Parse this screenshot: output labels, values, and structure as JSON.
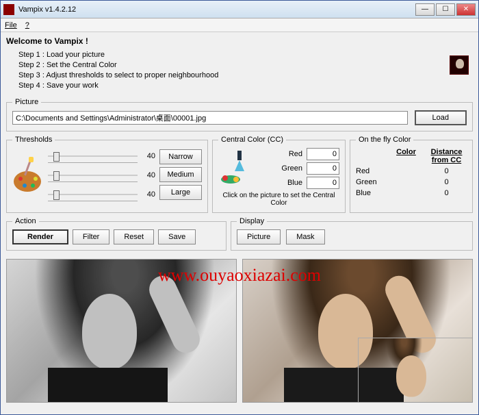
{
  "window": {
    "title": "Vampix v1.4.2.12"
  },
  "menu": {
    "file": "File",
    "help": "?"
  },
  "welcome": {
    "heading": "Welcome to Vampix !",
    "steps": [
      "Step 1 : Load your picture",
      "Step 2 : Set the Central Color",
      "Step 3 : Adjust thresholds to select to proper neighbourhood",
      "Step 4 : Save your work"
    ]
  },
  "picture": {
    "legend": "Picture",
    "path": "C:\\Documents and Settings\\Administrator\\桌面\\00001.jpg",
    "load": "Load"
  },
  "thresholds": {
    "legend": "Thresholds",
    "values": [
      "40",
      "40",
      "40"
    ],
    "narrow": "Narrow",
    "medium": "Medium",
    "large": "Large"
  },
  "cc": {
    "legend": "Central Color (CC)",
    "red_label": "Red",
    "red": "0",
    "green_label": "Green",
    "green": "0",
    "blue_label": "Blue",
    "blue": "0",
    "hint": "Click on the picture to set the Central Color"
  },
  "otf": {
    "legend": "On the fly Color",
    "col_color": "Color",
    "col_dist": "Distance from CC",
    "red_label": "Red",
    "red_dist": "0",
    "green_label": "Green",
    "green_dist": "0",
    "blue_label": "Blue",
    "blue_dist": "0"
  },
  "action": {
    "legend": "Action",
    "render": "Render",
    "filter": "Filter",
    "reset": "Reset",
    "save": "Save"
  },
  "display": {
    "legend": "Display",
    "picture": "Picture",
    "mask": "Mask"
  },
  "watermark": "www.ouyaoxiazai.com"
}
